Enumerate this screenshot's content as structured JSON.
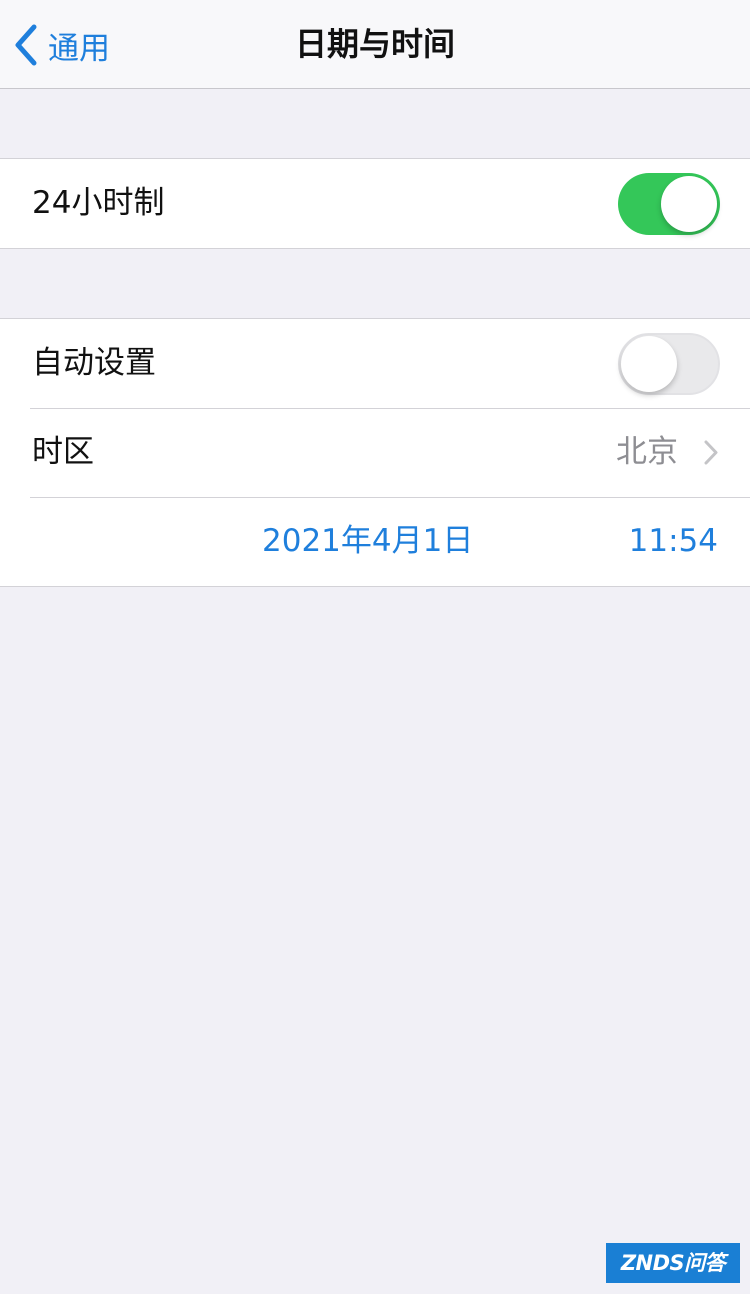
{
  "nav": {
    "back_label": "通用",
    "title": "日期与时间"
  },
  "group1": {
    "hour24_label": "24小时制",
    "hour24_enabled": true
  },
  "group2": {
    "auto_label": "自动设置",
    "auto_enabled": false,
    "timezone_label": "时区",
    "timezone_value": "北京",
    "date": "2021年4月1日",
    "time": "11:54"
  },
  "colors": {
    "accent": "#1f7fdc",
    "toggle_on": "#34c759",
    "toggle_off": "#e9e9eb",
    "background": "#f1f0f6"
  },
  "icons": {
    "back": "chevron-left-icon",
    "disclosure": "chevron-right-icon"
  },
  "watermark": {
    "text": "ZNDS问答"
  }
}
